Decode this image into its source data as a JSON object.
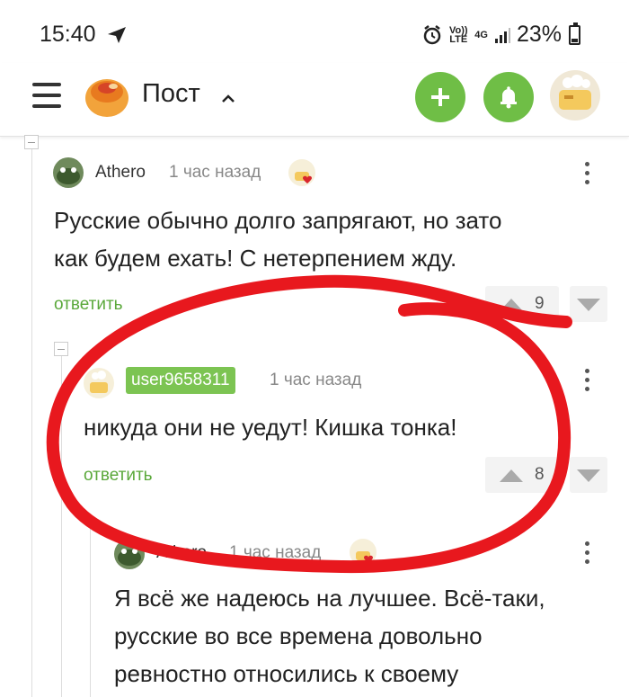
{
  "status": {
    "time": "15:40",
    "volte": "Vo)) LTE",
    "net": "4G",
    "battery": "23%"
  },
  "header": {
    "title": "Пост"
  },
  "comments": [
    {
      "user": "Athero",
      "time": "1 час назад",
      "text_line1": "Русские обычно долго запрягают, но зато",
      "text_line2": "как будем ехать! С нетерпением жду.",
      "reply": "ответить",
      "votes": "9"
    },
    {
      "user": "user9658311",
      "time": "1 час назад",
      "text_line1": "никуда они не уедут! Кишка тонка!",
      "reply": "ответить",
      "votes": "8"
    },
    {
      "user": "Athero",
      "time": "1 час назад",
      "text_line1": "Я всё же надеюсь на лучшее. Всё-таки,",
      "text_line2": "русские во все времена довольно",
      "text_line3": "ревностно относились к своему"
    }
  ],
  "colors": {
    "accent": "#6fbe46",
    "reply": "#5aa83a",
    "annotation": "#e8181e"
  }
}
